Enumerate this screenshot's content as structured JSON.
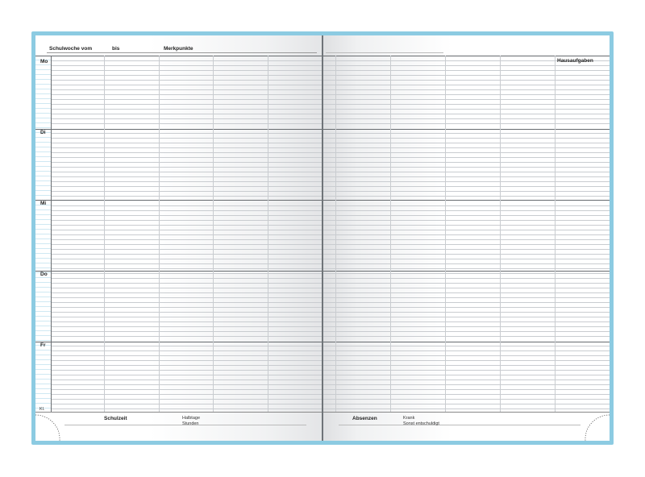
{
  "header": {
    "week_from": "Schulwoche vom",
    "until": "bis",
    "notes": "Merkpunkte",
    "homework": "Hausaufgaben"
  },
  "days": [
    "Mo",
    "Di",
    "Mi",
    "Do",
    "Fr"
  ],
  "class_label": "Kl.",
  "footer": {
    "school_time": "Schulzeit",
    "half_days": "Halbtage",
    "hours": "Stunden",
    "absences": "Absenzen",
    "sick": "Krank",
    "excused_other": "Sonst entschuldigt"
  },
  "colors": {
    "cover": "#8ccbe2",
    "rule_light": "#c9ccd0",
    "rule_dark": "#666a6e",
    "margin_stripe": "#cfe8f2"
  }
}
